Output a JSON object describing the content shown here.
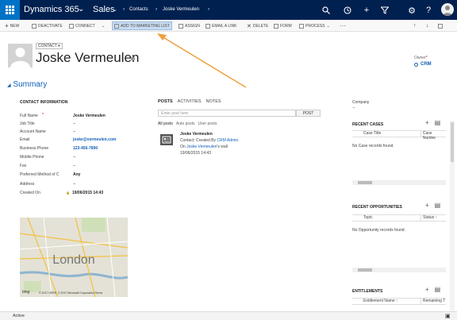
{
  "nav": {
    "app_name": "Dynamics 365",
    "module": "Sales",
    "breadcrumb": [
      "Contacts",
      "Joske Vermeulen"
    ],
    "icons": [
      "search-icon",
      "history-icon",
      "add-icon",
      "filter-icon",
      "settings-icon",
      "help-icon",
      "user-avatar"
    ]
  },
  "commands": [
    "NEW",
    "DEACTIVATE",
    "CONNECT",
    "ADD TO MARKETING LIST",
    "ASSIGN",
    "EMAIL A LINK",
    "DELETE",
    "FORM",
    "PROCESS"
  ],
  "header": {
    "entity_type": "CONTACT",
    "name": "Joske Vermeulen",
    "owner_label": "Owner",
    "owner_value": "CRM"
  },
  "summary_title": "Summary",
  "contact_info": {
    "title": "CONTACT INFORMATION",
    "fields": [
      {
        "label": "Full Name",
        "value": "Joske Vermeulen"
      },
      {
        "label": "Job Title",
        "value": "--"
      },
      {
        "label": "Account Name",
        "value": "--"
      },
      {
        "label": "Email",
        "value": "joske@vermeulen.com"
      },
      {
        "label": "Business Phone",
        "value": "123-456-7890"
      },
      {
        "label": "Mobile Phone",
        "value": "--"
      },
      {
        "label": "Fax",
        "value": "--"
      },
      {
        "label": "Preferred Method of C",
        "value": "Any"
      },
      {
        "label": "Address",
        "value": "--"
      },
      {
        "label": "Created On",
        "value": "19/06/2015    14:43"
      }
    ]
  },
  "map": {
    "city": "London",
    "credits": "© 2017 HERE, © 2017 Microsoft Corporation  Terms",
    "logo": "bing"
  },
  "posts": {
    "tabs": [
      "POSTS",
      "ACTIVITIES",
      "NOTES"
    ],
    "placeholder": "Enter post here",
    "post_button": "POST",
    "filters": [
      "All posts",
      "Auto posts",
      "User posts"
    ],
    "entry": {
      "author": "Joske Vermeulen",
      "line1_prefix": "Contact: Created By ",
      "line1_link": "CRM Admin.",
      "line2_prefix": "On ",
      "line2_link": "Joske Vermeulen",
      "line2_suffix": "'s wall",
      "timestamp": "19/06/2015 14:43"
    }
  },
  "right": {
    "company_label": "Company",
    "company_value": "--",
    "recent_cases": {
      "title": "RECENT CASES",
      "cols": [
        "Case Title",
        "Case Numbe"
      ],
      "empty": "No Case records found."
    },
    "recent_opportunities": {
      "title": "RECENT OPPORTUNITIES",
      "cols": [
        "Topic",
        "Status"
      ],
      "empty": "No Opportunity records found."
    },
    "entitlements": {
      "title": "ENTITLEMENTS",
      "cols": [
        "Entitlement Name",
        "Remaining T"
      ]
    }
  },
  "status": {
    "text": "Active"
  },
  "colors": {
    "nav": "#002050",
    "grid": "#0072c6",
    "link": "#1160b7",
    "annotation_arrow": "#f0a040"
  }
}
